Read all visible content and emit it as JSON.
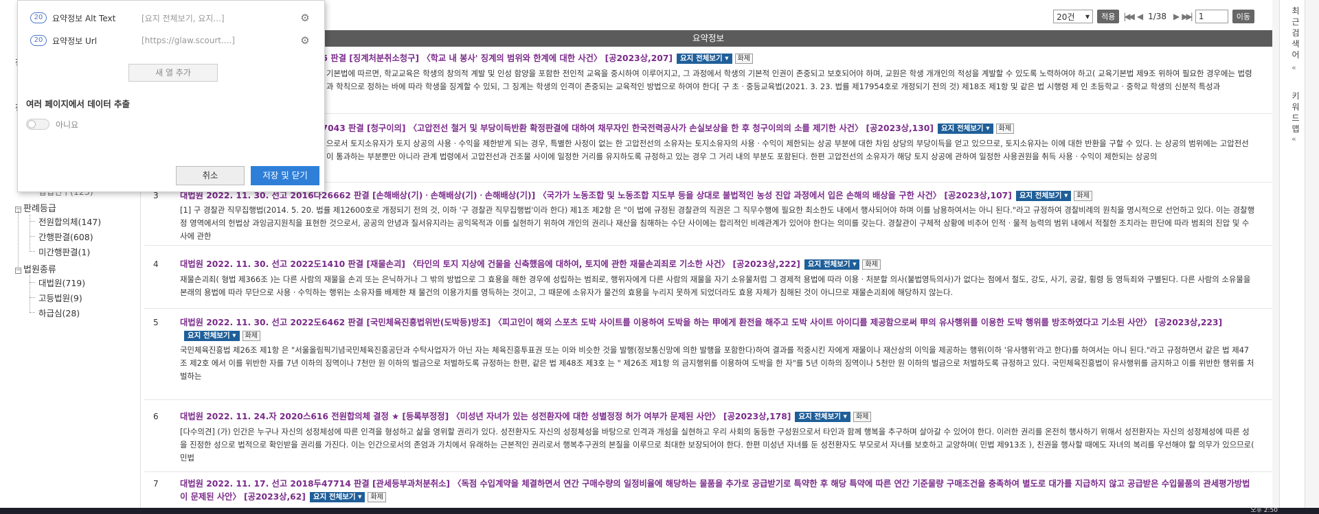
{
  "left_tree": {
    "partial_top": [
      "전",
      "전",
      "입법연구(123)"
    ],
    "groups": [
      {
        "label": "판례등급",
        "items": [
          "전원합의체(147)",
          "간행판결(608)",
          "미간행판결(1)"
        ]
      },
      {
        "label": "법원종류",
        "items": [
          "대법원(719)",
          "고등법원(9)",
          "하급심(28)"
        ]
      }
    ]
  },
  "popup": {
    "rows": [
      {
        "num": "20",
        "name": "요약정보 Alt Text",
        "value": "[요지 전체보기, 요지...]"
      },
      {
        "num": "20",
        "name": "요약정보 Url",
        "value": "[https://glaw.scourt....]"
      }
    ],
    "add_column": "새 열 추가",
    "multi_page_label": "여러 페이지에서 데이터 추출",
    "toggle_label": "아니요",
    "cancel": "취소",
    "save_close": "저장 및 닫기"
  },
  "pager": {
    "per_page": "20건",
    "apply": "적용",
    "page_info": "1/38",
    "page_input": "1",
    "go": "이동"
  },
  "table_header": "요약정보",
  "badge_label": "요지 전체보기",
  "badge2_label": "화제",
  "rows": [
    {
      "num": "",
      "title": "85 판결 [징계처분취소청구] 〈학교 내 봉사' 징계의 범위와 한계에 대한 사건〉 [공2023상,207]",
      "body": "기본법에 따르면, 학교교육은 학생의 창의적 계발 및 인성 함양을 포함한 전인적 교육을 중시하여 이루어지고, 그 과정에서 학생의 기본적 인권이 존중되고 보호되어야 하며, 교원은 학생 개개인의 적성을 계발할 수 있도록 노력하여야 하고( 교육기본법 제9조 위하여 필요한 경우에는 법령과 학칙으로 정하는 바에 따라 학생을 징계할 수 있되, 그 징계는 학생의 인격이 존중되는 교육적인 방법으로 하여야 한다[ 구 초ㆍ중등교육법(2021. 3. 23. 법률 제17954호로 개정되기 전의 것) 제18조 제1항 및 같은 법 시행령 제 인 초등학교ㆍ중학교 학생의 신분적 특성과"
    },
    {
      "num": "",
      "title": "57043 판결 [청구이의] 〈고압전선 철거 및 부당이득반환 확정판결에 대하여 채무자인 한국전력공사가 손실보상을 한 후 청구이의의 소를 제기한 사건〉 [공2023상,130]",
      "body": "으로서 토지소유자가 토지 상공의 사용ㆍ수익을 제한받게 되는 경우, 특별한 사정이 없는 한 고압전선의 소유자는 토지소유자의 사용ㆍ수익이 제한되는 상공 부분에 대한 차임 상당의 부당이득을 얻고 있으므로, 토지소유자는 이에 대한 반환을 구할 수 있다. 는 상공의 범위에는 고압전선이 통과하는 부분뿐만 아니라 관계 법령에서 고압전선과 건조물 사이에 일정한 거리를 유지하도록 규정하고 있는 경우 그 거리 내의 부분도 포함된다. 한편 고압전선의 소유자가 해당 토지 상공에 관하여 일정한 사용권원을 취득 사용ㆍ수익이 제한되는 상공의"
    },
    {
      "num": "3",
      "title": "대법원 2022. 11. 30. 선고 2016다26662 판결 [손해배상(기)ㆍ손해배상(기)ㆍ손해배상(기)] 〈국가가 노동조합 및 노동조합 지도부 등을 상대로 불법적인 농성 진압 과정에서 입은 손해의 배상을 구한 사건〉 [공2023상,107]",
      "body": "[1] 구 경찰관 직무집행법(2014. 5. 20. 법률 제12600호로 개정되기 전의 것, 이하 '구 경찰관 직무집행법'이라 한다) 제1조 제2항 은 \"이 법에 규정된 경찰관의 직권은 그 직무수행에 필요한 최소한도 내에서 행사되어야 하며 이를 남용하여서는 아니 된다.\"라고 규정하여 경찰비례의 원칙을 명시적으로 선언하고 있다. 이는 경찰행정 영역에서의 헌법상 과잉금지원칙을 표현한 것으로서, 공공의 안녕과 질서유지라는 공익목적과 이를 실현하기 위하여 개인의 권리나 재산을 침해하는 수단 사이에는 합리적인 비례관계가 있어야 한다는 의미를 갖는다. 경찰관이 구체적 상황에 비추어 인적ㆍ물적 능력의 범위 내에서 적절한 조치라는 판단에 따라 범죄의 진압 및 수사에 관한"
    },
    {
      "num": "4",
      "title": "대법원 2022. 11. 30. 선고 2022도1410 판결 [재물손괴] 〈타인의 토지 지상에 건물을 신축했음에 대하여, 토지에 관한 재물손괴죄로 기소한 사건〉 [공2023상,222]",
      "body": "재물손괴죄( 형법 제366조 )는 다른 사람의 재물을 손괴 또는 은닉하거나 그 밖의 방법으로 그 효용을 해한 경우에 성립하는 범죄로, 행위자에게 다른 사람의 재물을 자기 소유물처럼 그 경제적 용법에 따라 이용ㆍ처분할 의사(불법영득의사)가 없다는 점에서 절도, 강도, 사기, 공갈, 횡령 등 영득죄와 구별된다. 다른 사람의 소유물을 본래의 용법에 따라 무단으로 사용ㆍ수익하는 행위는 소유자를 배제한 채 물건의 이용가치를 영득하는 것이고, 그 때문에 소유자가 물건의 효용을 누리지 못하게 되었더라도 효용 자체가 침해된 것이 아니므로 재물손괴죄에 해당하지 않는다."
    },
    {
      "num": "5",
      "title": "대법원 2022. 11. 30. 선고 2022도6462 판결 [국민체육진흥법위반(도박등)방조] 〈피고인이 해외 스포츠 도박 사이트를 이용하여 도박을 하는 甲에게 환전을 해주고 도박 사이트 아이디를 제공함으로써 甲의 유사행위를 이용한 도박 행위를 방조하였다고 기소된 사안〉 [공2023상,223]",
      "body": "국민체육진흥법 제26조 제1항 은 \"서울올림픽기념국민체육진흥공단과 수탁사업자가 아닌 자는 체육진흥투표권 또는 이와 비슷한 것을 발행(정보통신망에 의한 발행을 포함한다)하여 결과를 적중시킨 자에게 재물이나 재산상의 이익을 제공하는 행위(이하 '유사행위'라고 한다)를 하여서는 아니 된다.\"라고 규정하면서 같은 법 제47조 제2호 에서 이를 위반한 자를 7년 이하의 징역이나 7천만 원 이하의 벌금으로 처벌하도록 규정하는 한편, 같은 법 제48조 제3호 는 \" 제26조 제1항 의 금지행위를 이용하여 도박을 한 자\"를 5년 이하의 징역이나 5천만 원 이하의 벌금으로 처벌하도록 규정하고 있다. 국민체육진흥법이 유사행위를 금지하고 이를 위반한 행위를 처벌하는"
    },
    {
      "num": "6",
      "title": "대법원 2022. 11. 24.자 2020스616 전원합의체 결정 ★ [등록부정정] 〈미성년 자녀가 있는 성전환자에 대한 성별정정 허가 여부가 문제된 사안〉 [공2023상,178]",
      "body": "[다수의견] (가) 인간은 누구나 자신의 성정체성에 따른 인격을 형성하고 삶을 영위할 권리가 있다. 성전환자도 자신의 성정체성을 바탕으로 인격과 개성을 실현하고 우리 사회의 동등한 구성원으로서 타인과 함께 행복을 추구하며 살아갈 수 있어야 한다. 이러한 권리를 온전히 행사하기 위해서 성전환자는 자신의 성정체성에 따른 성을 진정한 성으로 법적으로 확인받을 권리를 가진다. 이는 인간으로서의 존엄과 가치에서 유래하는 근본적인 권리로서 행복추구권의 본질을 이루므로 최대한 보장되어야 한다. 한편 미성년 자녀를 둔 성전환자도 부모로서 자녀를 보호하고 교양하며( 민법 제913조 ), 친권을 행사할 때에도 자녀의 복리를 우선해야 할 의무가 있으므로( 민법"
    },
    {
      "num": "7",
      "title": "대법원 2022. 11. 17. 선고 2018두47714 판결 [관세등부과처분취소] 〈독점 수입계약을 체결하면서 연간 구매수량의 일정비율에 해당하는 물품을 추가로 공급받기로 특약한 후 해당 특약에 따른 연간 기준물량 구매조건을 충족하여 별도로 대가를 지급하지 않고 공급받은 수입물품의 관세평가방법이 문제된 사안〉 [공2023상,62]",
      "body": ""
    }
  ],
  "right_sidebar": {
    "recent": "최근검색어",
    "keyword": "키워드맵"
  },
  "taskbar_time": "오후 2:50"
}
